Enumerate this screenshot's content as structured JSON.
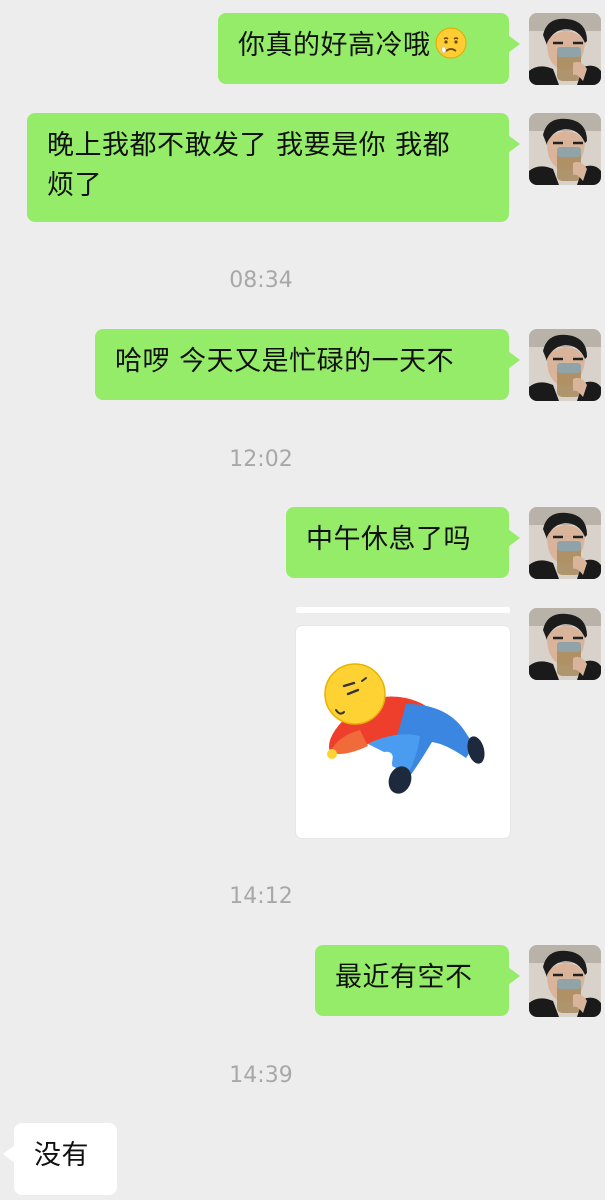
{
  "messages": [
    {
      "side": "out",
      "text": "你真的好高冷哦",
      "emoji": "worried-face-emoji"
    },
    {
      "side": "out",
      "line1": "晚上我都不敢发了 我要是你 我都",
      "line2": "烦了"
    },
    {
      "type": "time",
      "text": "08:34"
    },
    {
      "side": "out",
      "text": "哈啰 今天又是忙碌的一天不"
    },
    {
      "type": "time",
      "text": "12:02"
    },
    {
      "side": "out",
      "text": "中午休息了吗"
    },
    {
      "side": "out",
      "type": "sticker",
      "sticker": "lying-down-person-sticker"
    },
    {
      "type": "time",
      "text": "14:12"
    },
    {
      "side": "out",
      "text": "最近有空不"
    },
    {
      "type": "time",
      "text": "14:39"
    },
    {
      "side": "in",
      "text": "没有"
    }
  ],
  "colors": {
    "background": "#ededed",
    "outgoing_bubble": "#95ec69",
    "incoming_bubble": "#ffffff",
    "timestamp": "#a8a8a8"
  }
}
